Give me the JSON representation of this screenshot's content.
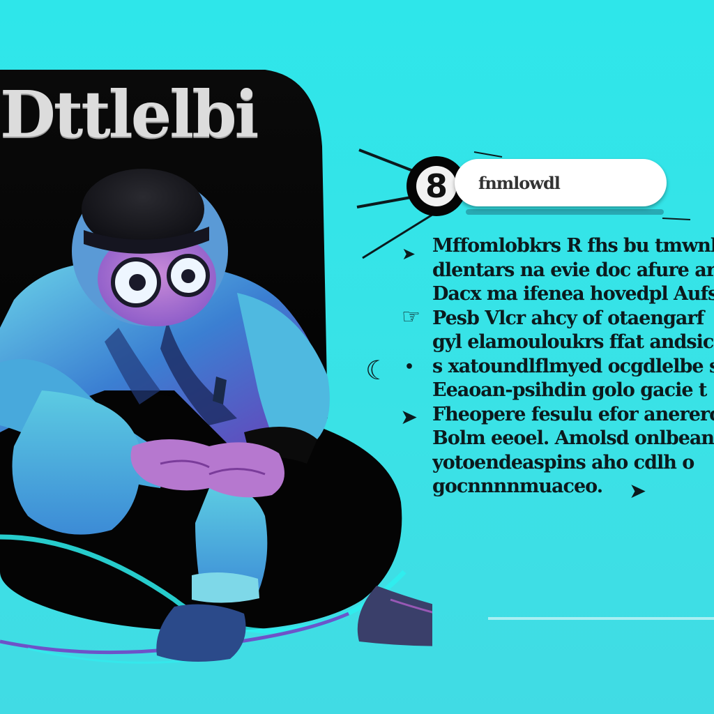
{
  "poster": {
    "title": "Dttlelbi",
    "badge_number": "8",
    "search_text": "fnmlowdl",
    "body_lines": [
      "Mffomlobkrs R fhs bu tmwnl",
      "dlentars na evie doc afure ar and",
      "Dacx ma ifenea hovedpl Aufsi",
      "Pesb Vlcr ahcy of otaengarf",
      "gyl elamouloukrs ffat andsiced",
      "s xatoundlflmyed ocgdlelbe s",
      "Eeaoan-psihdin golo gacie t",
      "Fheopere fesulu efor anererc",
      "Bolm eeoel. Amolsd onlbean",
      "yotoendeaspins aho cdlh o",
      "gocnnnnmuaceo."
    ],
    "bullets": [
      "arrow-bullet-icon",
      "hand-bullet-icon",
      "crescent-bullet-icon",
      "dot-bullet-icon",
      "arrow-bullet-icon",
      "chevron-arrow-icon"
    ],
    "colors": {
      "background": "#33e3e6",
      "chair": "#050505",
      "chair_rim": "#2ef0f0",
      "figure_primary": "#3a7fd0",
      "figure_accent": "#b05fc8",
      "text": "#0b1a1d"
    }
  }
}
